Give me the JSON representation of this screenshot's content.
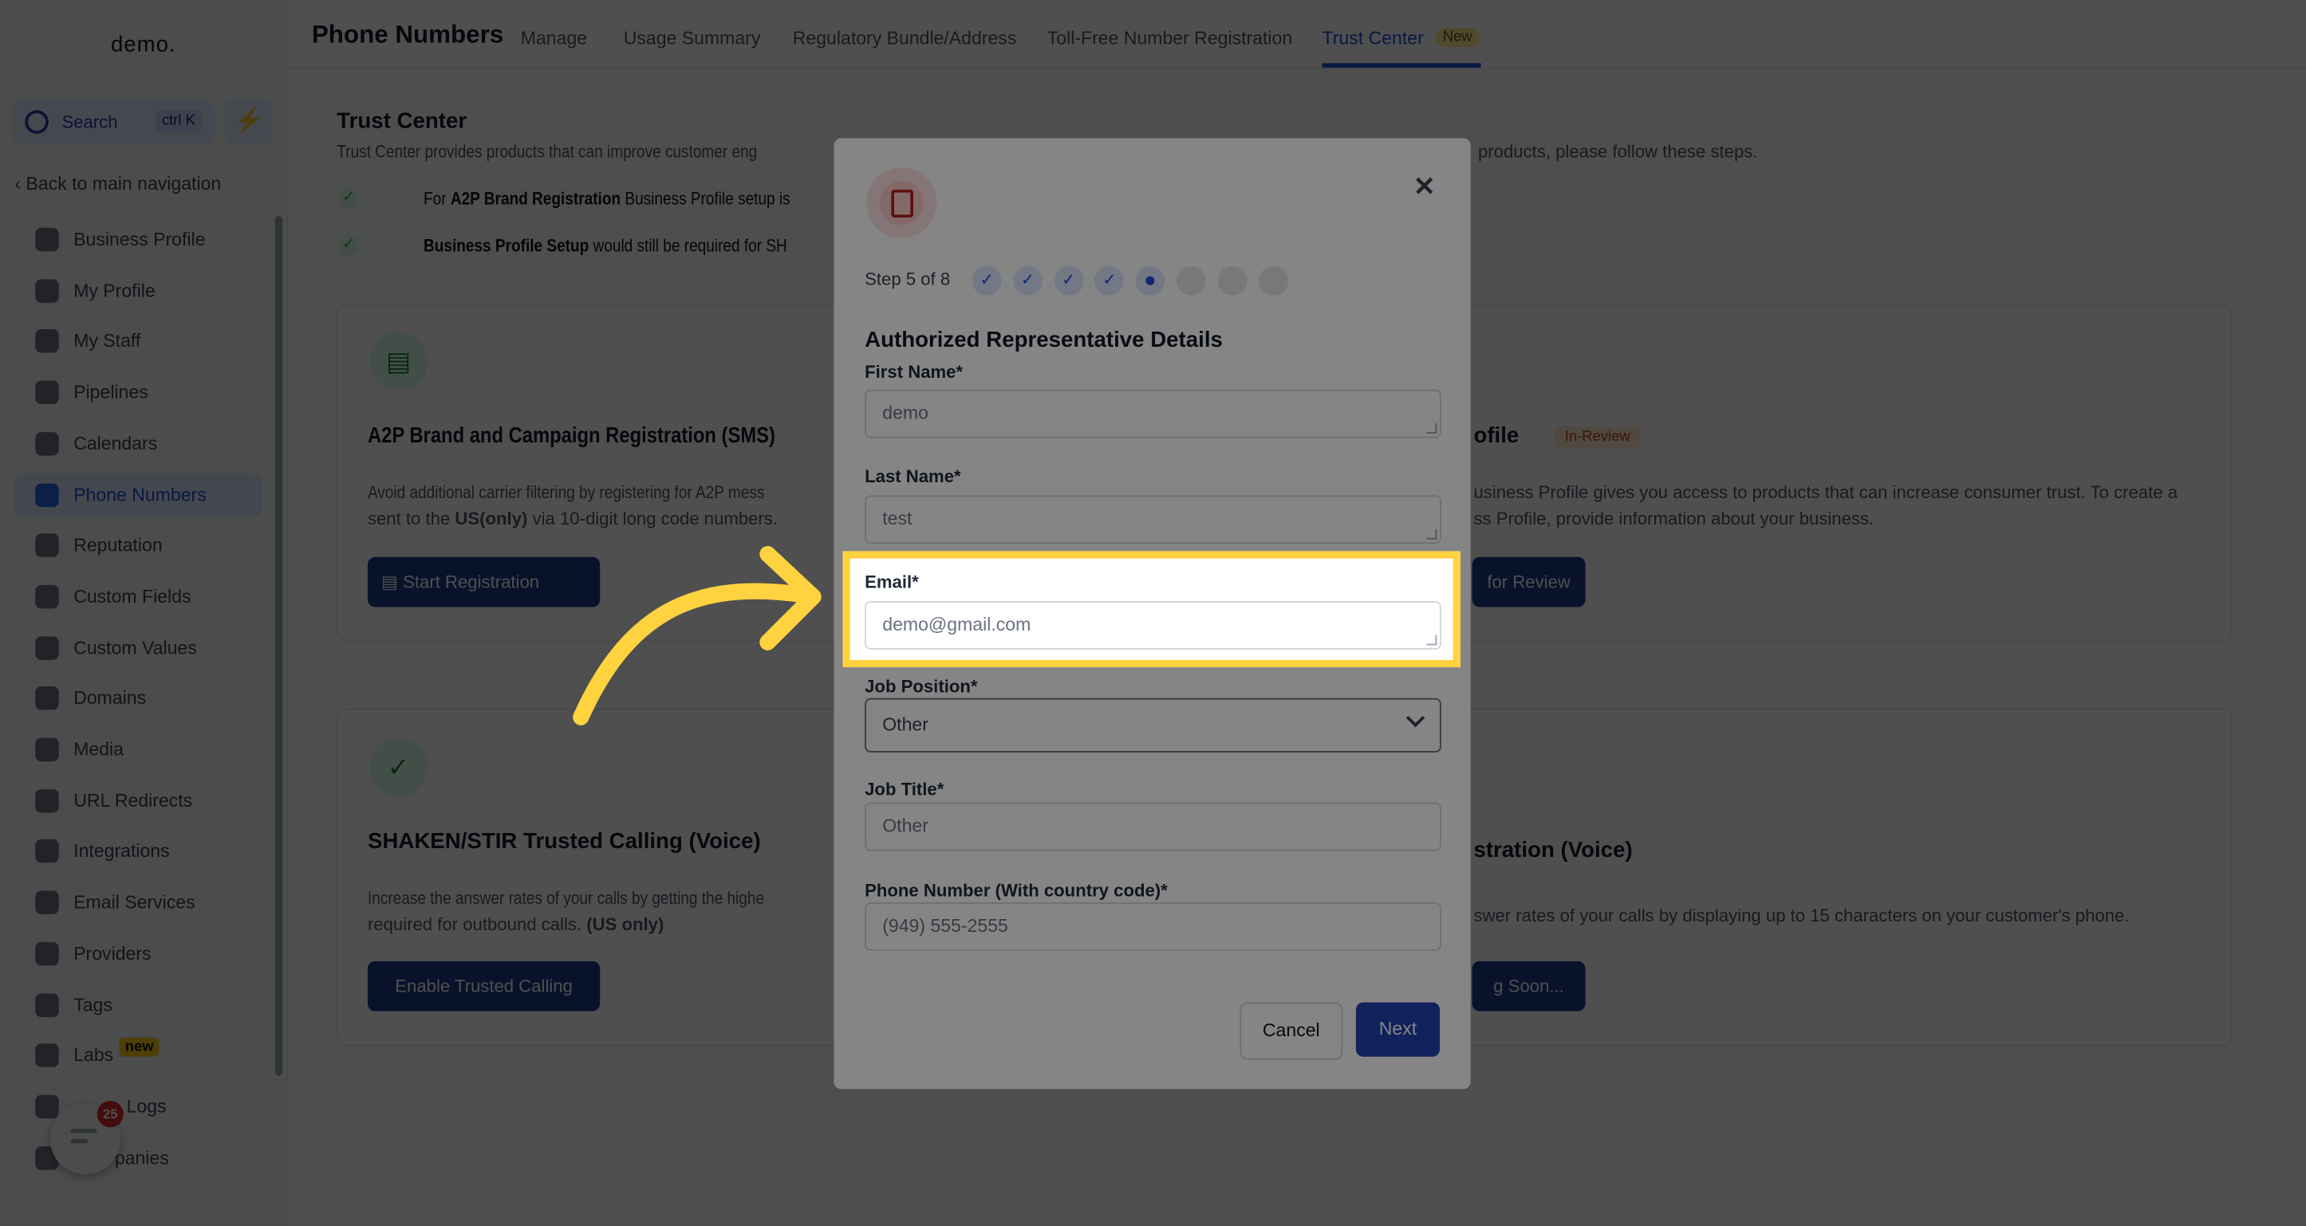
{
  "sidebar": {
    "logo": "demo.",
    "search_label": "Search",
    "search_shortcut": "ctrl K",
    "back_label": "Back to main navigation",
    "items": [
      {
        "label": "Business Profile",
        "icon": "briefcase-icon"
      },
      {
        "label": "My Profile",
        "icon": "user-circle-icon"
      },
      {
        "label": "My Staff",
        "icon": "user-icon"
      },
      {
        "label": "Pipelines",
        "icon": "filter-icon"
      },
      {
        "label": "Calendars",
        "icon": "calendar-icon"
      },
      {
        "label": "Phone Numbers",
        "icon": "phone-icon",
        "active": true
      },
      {
        "label": "Reputation",
        "icon": "star-icon"
      },
      {
        "label": "Custom Fields",
        "icon": "fields-icon"
      },
      {
        "label": "Custom Values",
        "icon": "tag-value-icon"
      },
      {
        "label": "Domains",
        "icon": "globe-icon"
      },
      {
        "label": "Media",
        "icon": "image-icon"
      },
      {
        "label": "URL Redirects",
        "icon": "redirect-icon"
      },
      {
        "label": "Integrations",
        "icon": "integrations-icon"
      },
      {
        "label": "Email Services",
        "icon": "mail-icon"
      },
      {
        "label": "Providers",
        "icon": "clipboard-icon"
      },
      {
        "label": "Tags",
        "icon": "tag-icon"
      },
      {
        "label": "Labs",
        "icon": "flask-icon"
      },
      {
        "label": "Logs",
        "icon": "bar-chart-icon"
      },
      {
        "label": "panies",
        "icon": "building-icon"
      }
    ],
    "labs_badge": "new"
  },
  "chat_widget": {
    "badge_count": "25"
  },
  "header": {
    "title": "Phone Numbers",
    "tabs": [
      "Manage",
      "Usage Summary",
      "Regulatory Bundle/Address",
      "Toll-Free Number Registration",
      "Trust Center"
    ],
    "active_tab": "Trust Center",
    "new_badge": "New"
  },
  "main": {
    "title": "Trust Center",
    "desc_left": "Trust Center provides products that can improve customer eng",
    "desc_right": "products, please follow these steps.",
    "notes": [
      {
        "bold": "A2P Brand Registration",
        "prefix": "For ",
        "rest": " Business Profile setup is"
      },
      {
        "bold": "Business Profile Setup",
        "prefix": "",
        "rest": " would still be required for SH"
      }
    ],
    "cards": [
      {
        "title": "A2P Brand and Campaign Registration (SMS)",
        "desc1": "Avoid additional carrier filtering by registering for A2P mess",
        "desc2_pre": "sent to the ",
        "desc2_bold": "US(only)",
        "desc2_post": " via 10-digit long code numbers.",
        "button": "Start Registration"
      },
      {
        "title": "SHAKEN/STIR Trusted Calling (Voice)",
        "desc1": "Increase the answer rates of your calls by getting the highe",
        "desc2_pre": "required for outbound calls. ",
        "desc2_bold": "(US only)",
        "desc2_post": "",
        "button": "Enable Trusted Calling"
      }
    ],
    "right_cards": [
      {
        "title": "ofile",
        "badge": "In-Review",
        "desc1": "usiness Profile gives you access to products that can increase consumer trust. To create a",
        "desc2": "ss Profile, provide information about your business.",
        "button": "for Review"
      },
      {
        "title": "stration (Voice)",
        "desc1": "swer rates of your calls by displaying up to 15 characters on your customer's phone.",
        "button": "g Soon..."
      }
    ]
  },
  "modal": {
    "step_text": "Step 5 of 8",
    "steps_total": 8,
    "current_step": 5,
    "title": "Authorized Representative Details",
    "fields": {
      "first_name": {
        "label": "First Name*",
        "value": "demo"
      },
      "last_name": {
        "label": "Last Name*",
        "value": "test"
      },
      "email": {
        "label": "Email*",
        "value": "demo@gmail.com"
      },
      "job_position": {
        "label": "Job Position*",
        "value": "Other"
      },
      "job_title": {
        "label": "Job Title*",
        "value": "Other"
      },
      "phone": {
        "label": "Phone Number (With country code)*",
        "value": "(949) 555-2555"
      }
    },
    "cancel": "Cancel",
    "next": "Next"
  },
  "colors": {
    "highlight": "#ffd23f",
    "primary": "#1e40af",
    "overlay": "#47484d"
  }
}
